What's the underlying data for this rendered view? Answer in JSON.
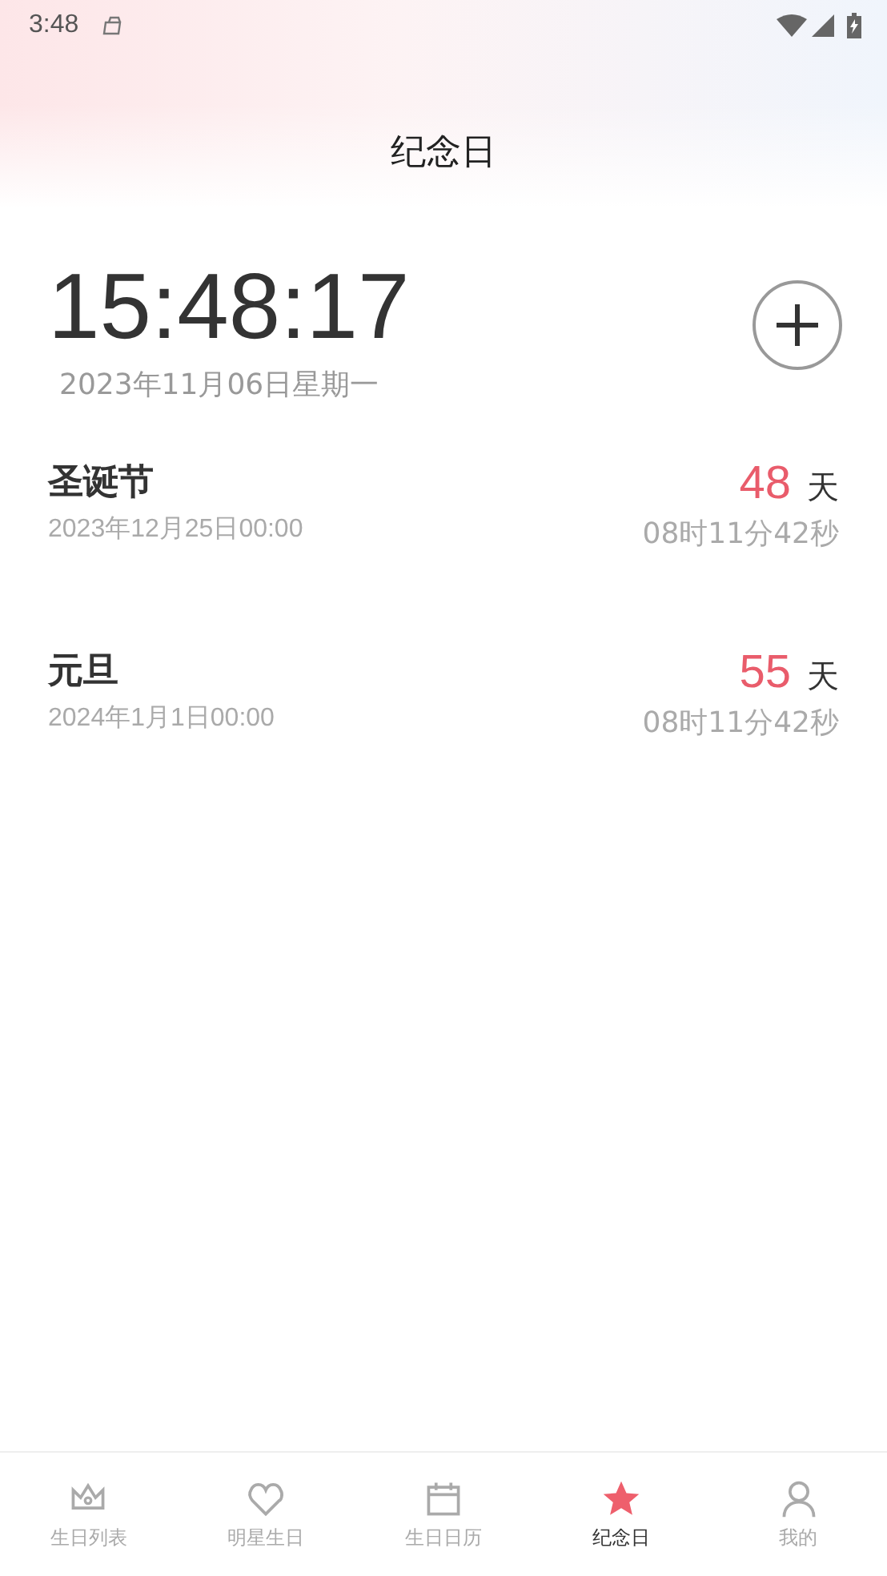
{
  "status_bar": {
    "time": "3:48"
  },
  "header": {
    "title": "纪念日"
  },
  "clock": {
    "time": "15:48:17",
    "date": "2023年11月06日星期一"
  },
  "events": [
    {
      "name": "圣诞节",
      "date": "2023年12月25日00:00",
      "days": "48",
      "unit": "天",
      "countdown": "08时11分42秒"
    },
    {
      "name": "元旦",
      "date": "2024年1月1日00:00",
      "days": "55",
      "unit": "天",
      "countdown": "08时11分42秒"
    }
  ],
  "tabs": [
    {
      "label": "生日列表",
      "kind": "crown",
      "selected": false
    },
    {
      "label": "明星生日",
      "kind": "heart",
      "selected": false
    },
    {
      "label": "生日日历",
      "kind": "calendar",
      "selected": false
    },
    {
      "label": "纪念日",
      "kind": "star",
      "selected": true
    },
    {
      "label": "我的",
      "kind": "person",
      "selected": false
    }
  ]
}
